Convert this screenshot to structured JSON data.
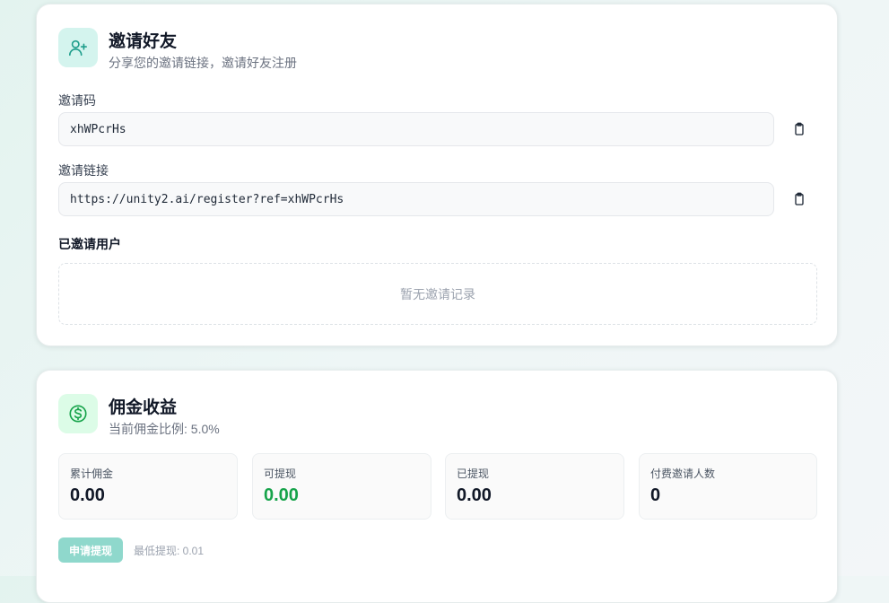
{
  "invite": {
    "title": "邀请好友",
    "subtitle": "分享您的邀请链接，邀请好友注册",
    "icon": "user-plus-icon",
    "code_label": "邀请码",
    "code_value": "xhWPcrHs",
    "link_label": "邀请链接",
    "link_value": "https://unity2.ai/register?ref=xhWPcrHs",
    "invited_title": "已邀请用户",
    "empty_text": "暂无邀请记录"
  },
  "commission": {
    "title": "佣金收益",
    "subtitle": "当前佣金比例: 5.0%",
    "icon": "dollar-circle-icon",
    "stats": [
      {
        "label": "累计佣金",
        "value": "0.00"
      },
      {
        "label": "可提现",
        "value": "0.00"
      },
      {
        "label": "已提现",
        "value": "0.00"
      },
      {
        "label": "付费邀请人数",
        "value": "0"
      }
    ],
    "withdraw_label": "申请提现",
    "min_withdraw": "最低提现: 0.01"
  },
  "colors": {
    "accent_teal": "#2bb3a0",
    "accent_green": "#16a34a",
    "button_bg": "#8fd8cc"
  }
}
